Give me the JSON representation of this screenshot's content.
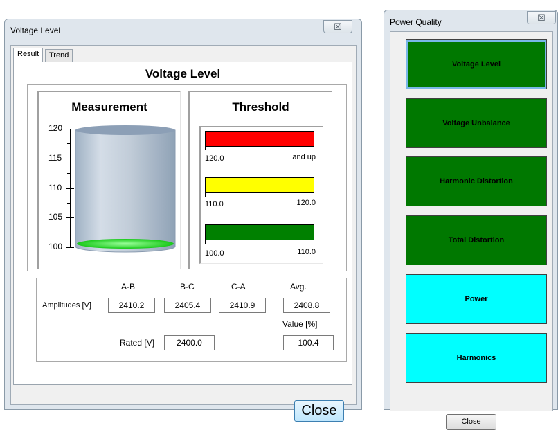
{
  "voltage_window": {
    "title": "Voltage Level",
    "close_x": "☒",
    "tabs": [
      {
        "label": "Result"
      },
      {
        "label": "Trend"
      }
    ],
    "heading": "Voltage Level",
    "measurement": {
      "title": "Measurement",
      "ticks": [
        "120",
        "115",
        "110",
        "105",
        "100"
      ],
      "fill_level_percent": 0
    },
    "threshold": {
      "title": "Threshold",
      "bands": [
        {
          "color": "#ff0000",
          "low": "120.0",
          "high": "and up"
        },
        {
          "color": "#ffff00",
          "low": "110.0",
          "high": "120.0"
        },
        {
          "color": "#008000",
          "low": "100.0",
          "high": "110.0"
        }
      ]
    },
    "readings": {
      "headers": [
        "A-B",
        "B-C",
        "C-A",
        "Avg."
      ],
      "amplitudes_label": "Amplitudes [V]",
      "amplitudes": [
        "2410.2",
        "2405.4",
        "2410.9",
        "2408.8"
      ],
      "value_label": "Value [%]",
      "rated_label": "Rated [V]",
      "rated": "2400.0",
      "value": "100.4"
    },
    "close_label": "Close"
  },
  "power_window": {
    "title": "Power Quality",
    "close_x": "☒",
    "buttons": [
      {
        "label": "Voltage Level",
        "color": "#007800"
      },
      {
        "label": "Voltage Unbalance",
        "color": "#007800"
      },
      {
        "label": "Harmonic Distortion",
        "color": "#007800"
      },
      {
        "label": "Total Distortion",
        "color": "#007800"
      },
      {
        "label": "Power",
        "color": "#00ffff"
      },
      {
        "label": "Harmonics",
        "color": "#00ffff"
      }
    ],
    "close_label": "Close"
  }
}
